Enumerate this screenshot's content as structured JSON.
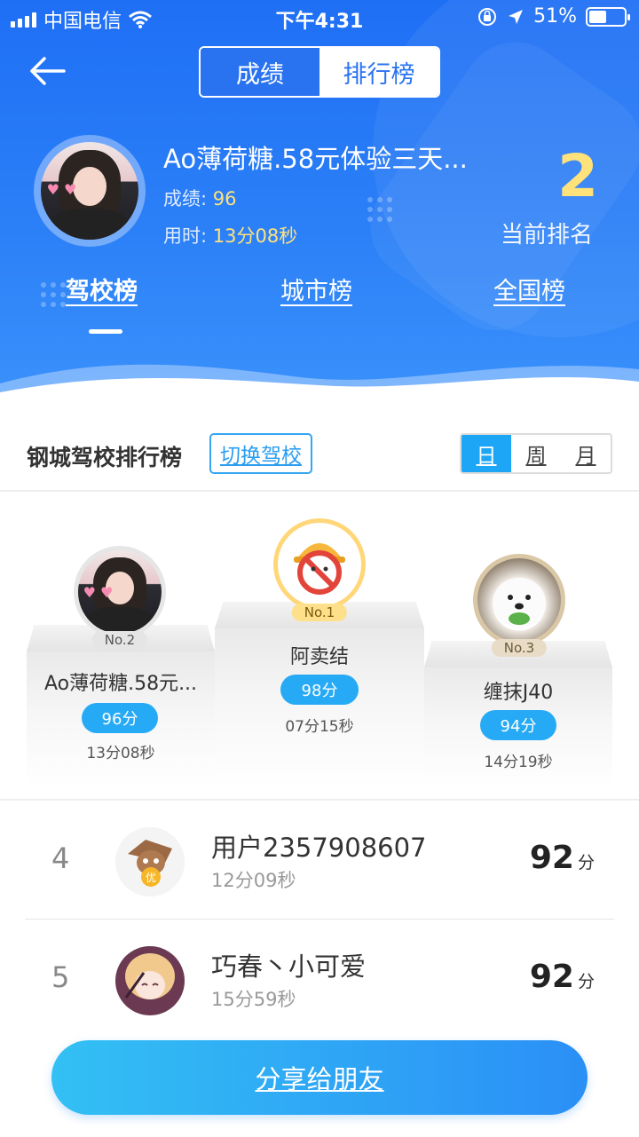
{
  "status_bar": {
    "carrier": "中国电信",
    "time": "下午4:31",
    "battery": "51%",
    "battery_level": 0.51
  },
  "header": {
    "segments": [
      "成绩",
      "排行榜"
    ],
    "active_segment": 1,
    "me": {
      "name": "Ao薄荷糖.58元体验三天...",
      "score_label": "成绩:",
      "score": "96",
      "time_label": "用时:",
      "time": "13分08秒"
    },
    "rank": {
      "value": "2",
      "label": "当前排名"
    },
    "board_tabs": [
      "驾校榜",
      "城市榜",
      "全国榜"
    ],
    "active_board_tab": 0
  },
  "school": {
    "title": "钢城驾校排行榜",
    "switch_label": "切换驾校",
    "periods": [
      "日",
      "周",
      "月"
    ],
    "active_period": 0
  },
  "podium": [
    {
      "badge": "No.2",
      "name": "Ao薄荷糖.58元...",
      "score": "96分",
      "time": "13分08秒"
    },
    {
      "badge": "No.1",
      "name": "阿卖结",
      "score": "98分",
      "time": "07分15秒"
    },
    {
      "badge": "No.3",
      "name": "缠抹J40",
      "score": "94分",
      "time": "14分19秒"
    }
  ],
  "list": [
    {
      "rank": "4",
      "name": "用户2357908607",
      "time": "12分09秒",
      "score": "92",
      "unit": "分"
    },
    {
      "rank": "5",
      "name": "巧春丶小可爱",
      "time": "15分59秒",
      "score": "92",
      "unit": "分"
    }
  ],
  "share_label": "分享给朋友",
  "colors": {
    "primary": "#2a73f0",
    "accent_yellow": "#ffe27a",
    "score_pill": "#27aaf5"
  }
}
